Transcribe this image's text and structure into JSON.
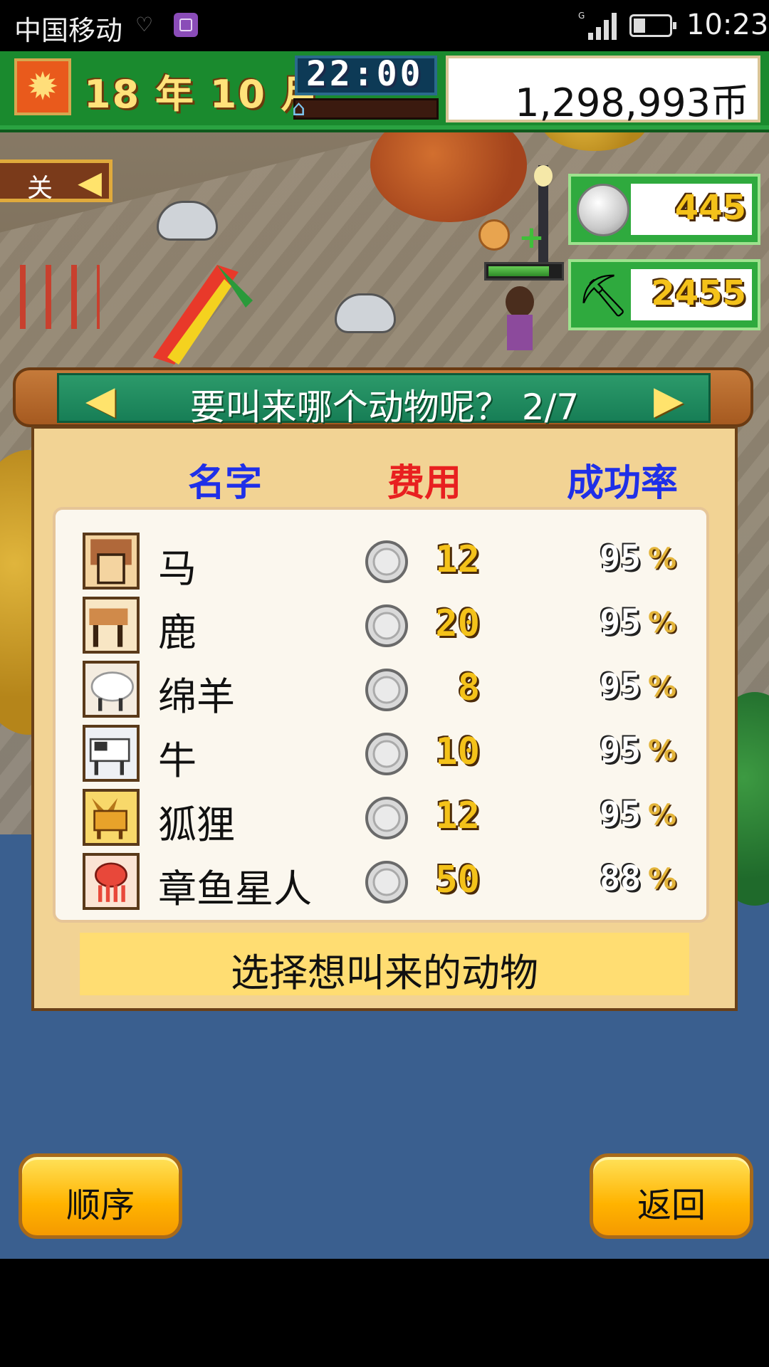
{
  "status_bar": {
    "carrier": "中国移动",
    "time": "10:23",
    "network": "G"
  },
  "hud": {
    "date": "18 年 10 月",
    "clock": "22:00",
    "money": "1,298,993币"
  },
  "side": {
    "toggle_label": "关",
    "coins": "445",
    "materials": "2455"
  },
  "dialog": {
    "title": "要叫来哪个动物呢？ 2/7",
    "columns": {
      "name": "名字",
      "cost": "费用",
      "rate": "成功率"
    },
    "rows": [
      {
        "name": "马",
        "cost": "12",
        "rate": "95",
        "icon": "horse-icon"
      },
      {
        "name": "鹿",
        "cost": "20",
        "rate": "95",
        "icon": "deer-icon"
      },
      {
        "name": "绵羊",
        "cost": "8",
        "rate": "95",
        "icon": "sheep-icon"
      },
      {
        "name": "牛",
        "cost": "10",
        "rate": "95",
        "icon": "cow-icon"
      },
      {
        "name": "狐狸",
        "cost": "12",
        "rate": "95",
        "icon": "fox-icon"
      },
      {
        "name": "章鱼星人",
        "cost": "50",
        "rate": "88",
        "icon": "octopus-alien-icon"
      }
    ],
    "percent_symbol": "%",
    "hint": "选择想叫来的动物"
  },
  "buttons": {
    "order": "顺序",
    "back": "返回"
  },
  "colors": {
    "name_header": "#1f2fe8",
    "cost_header": "#e82020",
    "rate_header": "#1f2fe8",
    "hud_green": "#1a8a2e",
    "button_yellow": "#ffb300"
  }
}
